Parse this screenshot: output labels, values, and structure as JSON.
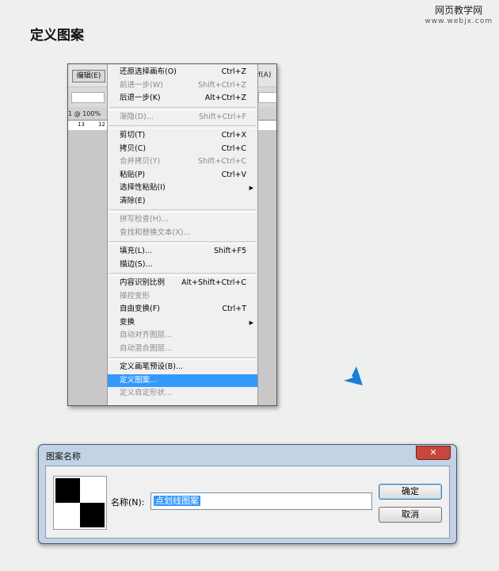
{
  "page": {
    "title": "定义图案"
  },
  "watermark": {
    "site": "网页教学网",
    "url": "www.webjx.com"
  },
  "ps": {
    "edit_menu": "编辑(E)",
    "right_menu": "f(A)",
    "zoom": "1 @ 100%",
    "ruler": [
      "13",
      "12"
    ],
    "menu": [
      {
        "label": "还原选择画布(O)",
        "shortcut": "Ctrl+Z",
        "disabled": false
      },
      {
        "label": "前进一步(W)",
        "shortcut": "Shift+Ctrl+Z",
        "disabled": true
      },
      {
        "label": "后退一步(K)",
        "shortcut": "Alt+Ctrl+Z",
        "disabled": false
      },
      {
        "sep": true
      },
      {
        "label": "渐隐(D)...",
        "shortcut": "Shift+Ctrl+F",
        "disabled": true
      },
      {
        "sep": true
      },
      {
        "label": "剪切(T)",
        "shortcut": "Ctrl+X",
        "disabled": false
      },
      {
        "label": "拷贝(C)",
        "shortcut": "Ctrl+C",
        "disabled": false
      },
      {
        "label": "合并拷贝(Y)",
        "shortcut": "Shift+Ctrl+C",
        "disabled": true
      },
      {
        "label": "粘贴(P)",
        "shortcut": "Ctrl+V",
        "disabled": false
      },
      {
        "label": "选择性粘贴(I)",
        "shortcut": "",
        "disabled": false,
        "submenu": true
      },
      {
        "label": "清除(E)",
        "shortcut": "",
        "disabled": false
      },
      {
        "sep": true
      },
      {
        "label": "拼写检查(H)...",
        "shortcut": "",
        "disabled": true
      },
      {
        "label": "查找和替换文本(X)...",
        "shortcut": "",
        "disabled": true
      },
      {
        "sep": true
      },
      {
        "label": "填充(L)...",
        "shortcut": "Shift+F5",
        "disabled": false
      },
      {
        "label": "描边(S)...",
        "shortcut": "",
        "disabled": false
      },
      {
        "sep": true
      },
      {
        "label": "内容识别比例",
        "shortcut": "Alt+Shift+Ctrl+C",
        "disabled": false
      },
      {
        "label": "操控变形",
        "shortcut": "",
        "disabled": true
      },
      {
        "label": "自由变换(F)",
        "shortcut": "Ctrl+T",
        "disabled": false
      },
      {
        "label": "变换",
        "shortcut": "",
        "disabled": false,
        "submenu": true
      },
      {
        "label": "自动对齐图层...",
        "shortcut": "",
        "disabled": true
      },
      {
        "label": "自动混合图层...",
        "shortcut": "",
        "disabled": true
      },
      {
        "sep": true
      },
      {
        "label": "定义画笔预设(B)...",
        "shortcut": "",
        "disabled": false
      },
      {
        "label": "定义图案...",
        "shortcut": "",
        "disabled": false,
        "highlight": true
      },
      {
        "label": "定义自定形状...",
        "shortcut": "",
        "disabled": true
      }
    ]
  },
  "dialog": {
    "title": "图案名称",
    "close": "✕",
    "name_label": "名称(N):",
    "name_value": "点划线图案",
    "ok": "确定",
    "cancel": "取消"
  },
  "colors": {
    "accent": "#3399ff",
    "arrow": "#1a7fd6"
  }
}
